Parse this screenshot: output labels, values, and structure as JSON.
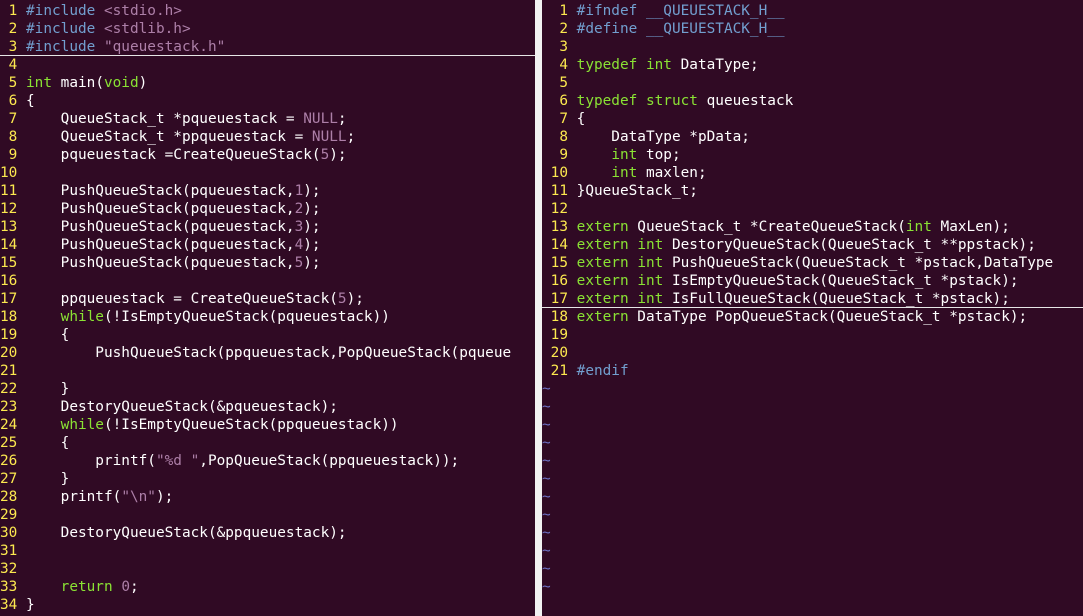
{
  "theme": {
    "background": "#300a24",
    "text": "#ffffff",
    "line_number": "#fce94f",
    "keyword": "#8ae234",
    "type": "#8ae234",
    "preproc": "#729fcf",
    "string": "#ad7fa8",
    "constant": "#ad7fa8",
    "tilde": "#6c71c4"
  },
  "left_pane": {
    "cursor_line": 3,
    "lines": [
      {
        "num": "1",
        "tokens": [
          [
            "p",
            "#include "
          ],
          [
            "s",
            "<stdio.h>"
          ]
        ]
      },
      {
        "num": "2",
        "tokens": [
          [
            "p",
            "#include "
          ],
          [
            "s",
            "<stdlib.h>"
          ]
        ]
      },
      {
        "num": "3",
        "tokens": [
          [
            "p",
            "#include "
          ],
          [
            "s",
            "\"queuestack.h\""
          ]
        ]
      },
      {
        "num": "4",
        "tokens": []
      },
      {
        "num": "5",
        "tokens": [
          [
            "t",
            "int"
          ],
          [
            "n",
            " main("
          ],
          [
            "t",
            "void"
          ],
          [
            "n",
            ")"
          ]
        ]
      },
      {
        "num": "6",
        "tokens": [
          [
            "n",
            "{"
          ]
        ]
      },
      {
        "num": "7",
        "tokens": [
          [
            "n",
            "    QueueStack_t *pqueuestack = "
          ],
          [
            "c",
            "NULL"
          ],
          [
            "n",
            ";"
          ]
        ]
      },
      {
        "num": "8",
        "tokens": [
          [
            "n",
            "    QueueStack_t *ppqueuestack = "
          ],
          [
            "c",
            "NULL"
          ],
          [
            "n",
            ";"
          ]
        ]
      },
      {
        "num": "9",
        "tokens": [
          [
            "n",
            "    pqueuestack =CreateQueueStack("
          ],
          [
            "c",
            "5"
          ],
          [
            "n",
            ");"
          ]
        ]
      },
      {
        "num": "10",
        "tokens": []
      },
      {
        "num": "11",
        "tokens": [
          [
            "n",
            "    PushQueueStack(pqueuestack,"
          ],
          [
            "c",
            "1"
          ],
          [
            "n",
            ");"
          ]
        ]
      },
      {
        "num": "12",
        "tokens": [
          [
            "n",
            "    PushQueueStack(pqueuestack,"
          ],
          [
            "c",
            "2"
          ],
          [
            "n",
            ");"
          ]
        ]
      },
      {
        "num": "13",
        "tokens": [
          [
            "n",
            "    PushQueueStack(pqueuestack,"
          ],
          [
            "c",
            "3"
          ],
          [
            "n",
            ");"
          ]
        ]
      },
      {
        "num": "14",
        "tokens": [
          [
            "n",
            "    PushQueueStack(pqueuestack,"
          ],
          [
            "c",
            "4"
          ],
          [
            "n",
            ");"
          ]
        ]
      },
      {
        "num": "15",
        "tokens": [
          [
            "n",
            "    PushQueueStack(pqueuestack,"
          ],
          [
            "c",
            "5"
          ],
          [
            "n",
            ");"
          ]
        ]
      },
      {
        "num": "16",
        "tokens": []
      },
      {
        "num": "17",
        "tokens": [
          [
            "n",
            "    ppqueuestack = CreateQueueStack("
          ],
          [
            "c",
            "5"
          ],
          [
            "n",
            ");"
          ]
        ]
      },
      {
        "num": "18",
        "tokens": [
          [
            "n",
            "    "
          ],
          [
            "k",
            "while"
          ],
          [
            "n",
            "(!IsEmptyQueueStack(pqueuestack))"
          ]
        ]
      },
      {
        "num": "19",
        "tokens": [
          [
            "n",
            "    {"
          ]
        ]
      },
      {
        "num": "20",
        "tokens": [
          [
            "n",
            "        PushQueueStack(ppqueuestack,PopQueueStack(pqueue"
          ]
        ]
      },
      {
        "num": "21",
        "tokens": []
      },
      {
        "num": "22",
        "tokens": [
          [
            "n",
            "    }"
          ]
        ]
      },
      {
        "num": "23",
        "tokens": [
          [
            "n",
            "    DestoryQueueStack(&pqueuestack);"
          ]
        ]
      },
      {
        "num": "24",
        "tokens": [
          [
            "n",
            "    "
          ],
          [
            "k",
            "while"
          ],
          [
            "n",
            "(!IsEmptyQueueStack(ppqueuestack))"
          ]
        ]
      },
      {
        "num": "25",
        "tokens": [
          [
            "n",
            "    {"
          ]
        ]
      },
      {
        "num": "26",
        "tokens": [
          [
            "n",
            "        printf("
          ],
          [
            "s",
            "\"%d \""
          ],
          [
            "n",
            ",PopQueueStack(ppqueuestack));"
          ]
        ]
      },
      {
        "num": "27",
        "tokens": [
          [
            "n",
            "    }"
          ]
        ]
      },
      {
        "num": "28",
        "tokens": [
          [
            "n",
            "    printf("
          ],
          [
            "s",
            "\"\\n\""
          ],
          [
            "n",
            ");"
          ]
        ]
      },
      {
        "num": "29",
        "tokens": []
      },
      {
        "num": "30",
        "tokens": [
          [
            "n",
            "    DestoryQueueStack(&ppqueuestack);"
          ]
        ]
      },
      {
        "num": "31",
        "tokens": []
      },
      {
        "num": "32",
        "tokens": []
      },
      {
        "num": "33",
        "tokens": [
          [
            "n",
            "    "
          ],
          [
            "k",
            "return"
          ],
          [
            "n",
            " "
          ],
          [
            "c",
            "0"
          ],
          [
            "n",
            ";"
          ]
        ]
      },
      {
        "num": "34",
        "tokens": [
          [
            "n",
            "}"
          ]
        ]
      }
    ]
  },
  "right_pane": {
    "cursor_line": 17,
    "tilde_char": "~",
    "tilde_count": 12,
    "lines": [
      {
        "num": "1",
        "tokens": [
          [
            "p",
            "#ifndef __QUEUESTACK_H__"
          ]
        ]
      },
      {
        "num": "2",
        "tokens": [
          [
            "p",
            "#define __QUEUESTACK_H__"
          ]
        ]
      },
      {
        "num": "3",
        "tokens": []
      },
      {
        "num": "4",
        "tokens": [
          [
            "t",
            "typedef"
          ],
          [
            "n",
            " "
          ],
          [
            "t",
            "int"
          ],
          [
            "n",
            " DataType;"
          ]
        ]
      },
      {
        "num": "5",
        "tokens": []
      },
      {
        "num": "6",
        "tokens": [
          [
            "t",
            "typedef"
          ],
          [
            "n",
            " "
          ],
          [
            "t",
            "struct"
          ],
          [
            "n",
            " queuestack"
          ]
        ]
      },
      {
        "num": "7",
        "tokens": [
          [
            "n",
            "{"
          ]
        ]
      },
      {
        "num": "8",
        "tokens": [
          [
            "n",
            "    DataType *pData;"
          ]
        ]
      },
      {
        "num": "9",
        "tokens": [
          [
            "n",
            "    "
          ],
          [
            "t",
            "int"
          ],
          [
            "n",
            " top;"
          ]
        ]
      },
      {
        "num": "10",
        "tokens": [
          [
            "n",
            "    "
          ],
          [
            "t",
            "int"
          ],
          [
            "n",
            " maxlen;"
          ]
        ]
      },
      {
        "num": "11",
        "tokens": [
          [
            "n",
            "}QueueStack_t;"
          ]
        ]
      },
      {
        "num": "12",
        "tokens": []
      },
      {
        "num": "13",
        "tokens": [
          [
            "t",
            "extern"
          ],
          [
            "n",
            " QueueStack_t *CreateQueueStack("
          ],
          [
            "t",
            "int"
          ],
          [
            "n",
            " MaxLen);"
          ]
        ]
      },
      {
        "num": "14",
        "tokens": [
          [
            "t",
            "extern"
          ],
          [
            "n",
            " "
          ],
          [
            "t",
            "int"
          ],
          [
            "n",
            " DestoryQueueStack(QueueStack_t **ppstack);"
          ]
        ]
      },
      {
        "num": "15",
        "tokens": [
          [
            "t",
            "extern"
          ],
          [
            "n",
            " "
          ],
          [
            "t",
            "int"
          ],
          [
            "n",
            " PushQueueStack(QueueStack_t *pstack,DataType"
          ]
        ]
      },
      {
        "num": "16",
        "tokens": [
          [
            "t",
            "extern"
          ],
          [
            "n",
            " "
          ],
          [
            "t",
            "int"
          ],
          [
            "n",
            " IsEmptyQueueStack(QueueStack_t *pstack);"
          ]
        ]
      },
      {
        "num": "17",
        "tokens": [
          [
            "t",
            "extern"
          ],
          [
            "n",
            " "
          ],
          [
            "t",
            "int"
          ],
          [
            "n",
            " IsFullQueueStack(QueueStack_t *pstack);"
          ]
        ]
      },
      {
        "num": "18",
        "tokens": [
          [
            "t",
            "extern"
          ],
          [
            "n",
            " DataType PopQueueStack(QueueStack_t *pstack);"
          ]
        ]
      },
      {
        "num": "19",
        "tokens": []
      },
      {
        "num": "20",
        "tokens": []
      },
      {
        "num": "21",
        "tokens": [
          [
            "p",
            "#endif"
          ]
        ]
      }
    ]
  }
}
